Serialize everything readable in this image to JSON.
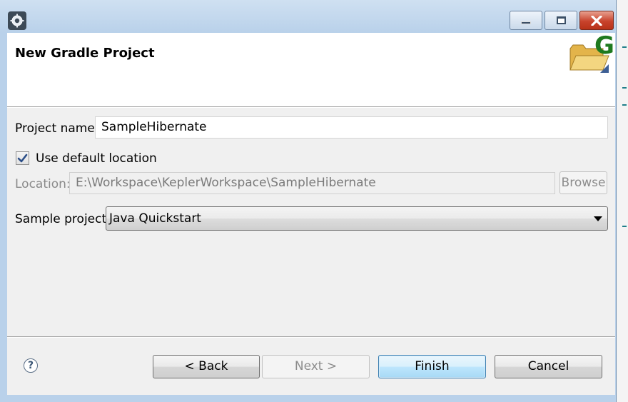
{
  "dialog": {
    "title": "New Gradle Project",
    "app_icon": "eclipse-gear-icon",
    "wizard_icon": "gradle-folder-icon",
    "wizard_icon_letter": "G"
  },
  "window_controls": {
    "minimize": "minimize-icon",
    "maximize": "maximize-icon",
    "close": "close-icon"
  },
  "form": {
    "project_name_label": "Project name:",
    "project_name_value": "SampleHibernate",
    "use_default_location_label": "Use default location",
    "use_default_location_checked": true,
    "location_label": "Location:",
    "location_value": "E:\\Workspace\\KeplerWorkspace\\SampleHibernate",
    "browse_label": "Browse",
    "sample_project_label": "Sample project:",
    "sample_project_selected": "Java Quickstart"
  },
  "footer": {
    "help_icon": "help-icon",
    "help_glyph": "?",
    "back_label": "< Back",
    "next_label": "Next >",
    "finish_label": "Finish",
    "cancel_label": "Cancel"
  },
  "colors": {
    "frame": "#b9d1ea",
    "close_button": "#c8432c",
    "default_button": "#3c7fb1",
    "gradle_green": "#1f7a1f"
  }
}
